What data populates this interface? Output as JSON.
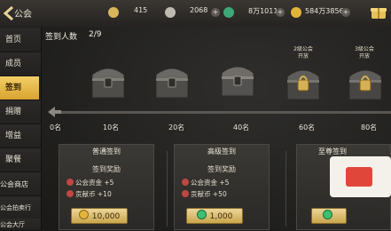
{
  "header": {
    "title": "公会",
    "resources": [
      {
        "icon": "crown-icon",
        "value": "415"
      },
      {
        "icon": "silver-coin-icon",
        "value": "2068"
      },
      {
        "icon": "jade-icon",
        "value": "8万1011"
      },
      {
        "icon": "gold-coin-icon",
        "value": "584万3856"
      }
    ],
    "plus": "+"
  },
  "sidebar": {
    "items": [
      {
        "label": "首页",
        "active": false
      },
      {
        "label": "成员",
        "active": false
      },
      {
        "label": "签到",
        "active": true
      },
      {
        "label": "捐赠",
        "active": false
      },
      {
        "label": "增益",
        "active": false
      },
      {
        "label": "聚餐",
        "active": false
      },
      {
        "label": "公会商店",
        "active": false
      },
      {
        "label": "公会拍卖行",
        "active": false
      },
      {
        "label": "公会大厅",
        "active": false
      }
    ]
  },
  "signin": {
    "count_label": "签到人数",
    "count_value": "2/9",
    "chests": [
      {
        "tag": ""
      },
      {
        "tag": ""
      },
      {
        "tag": ""
      },
      {
        "tag": "2级公会\n开放"
      },
      {
        "tag": "3级公会\n开放"
      }
    ],
    "milestones": [
      "0名",
      "10名",
      "20名",
      "40名",
      "60名",
      "80名"
    ]
  },
  "panels": [
    {
      "title": "普通签到",
      "subtitle": "签到奖励",
      "rewards": [
        "公会资金 +5",
        "贡献币 +10"
      ],
      "price": "10,000",
      "currency": "coin"
    },
    {
      "title": "高级签到",
      "subtitle": "签到奖励",
      "rewards": [
        "公会资金 +5",
        "贡献币 +50"
      ],
      "price": "1,000",
      "currency": "gem"
    },
    {
      "title": "至尊签到",
      "subtitle": "",
      "rewards": [],
      "price": "",
      "currency": "gem"
    }
  ],
  "colors": {
    "accent_gold": "#d9a431",
    "coin_gold": "#e2b43a",
    "gem_green": "#3ec070",
    "reward_red": "#c0473f"
  }
}
